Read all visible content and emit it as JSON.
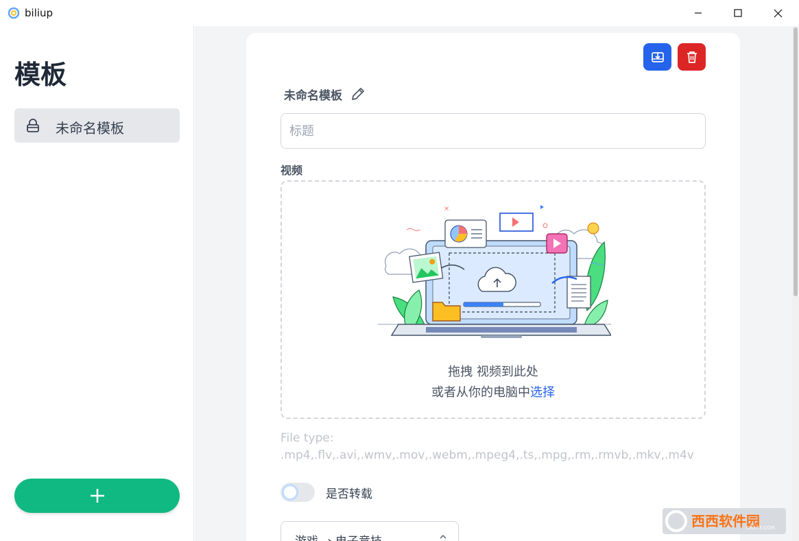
{
  "window": {
    "title": "biliup"
  },
  "sidebar": {
    "heading": "模板",
    "items": [
      {
        "label": "未命名模板",
        "icon": "lock-icon"
      }
    ],
    "add_icon": "plus-icon"
  },
  "editor": {
    "template_name": "未命名模板",
    "title_input": {
      "placeholder": "标题",
      "value": ""
    },
    "video_section_label": "视频",
    "dropzone": {
      "line1": "拖拽 视频到此处",
      "line2_prefix": "或者从你的电脑中",
      "line2_link": "选择"
    },
    "file_type_label": "File type:",
    "file_types": ".mp4,.flv,.avi,.wmv,.mov,.webm,.mpeg4,.ts,.mpg,.rm,.rmvb,.mkv,.m4v",
    "reprint_toggle": {
      "label": "是否转载",
      "checked": false
    },
    "category_select": {
      "value": "游戏 → 电子竞技"
    }
  },
  "watermark": {
    "text": "西西软件园",
    "sub": "CR173.COM"
  },
  "colors": {
    "accent_blue": "#2563eb",
    "danger_red": "#dc2626",
    "add_green": "#10b981"
  }
}
